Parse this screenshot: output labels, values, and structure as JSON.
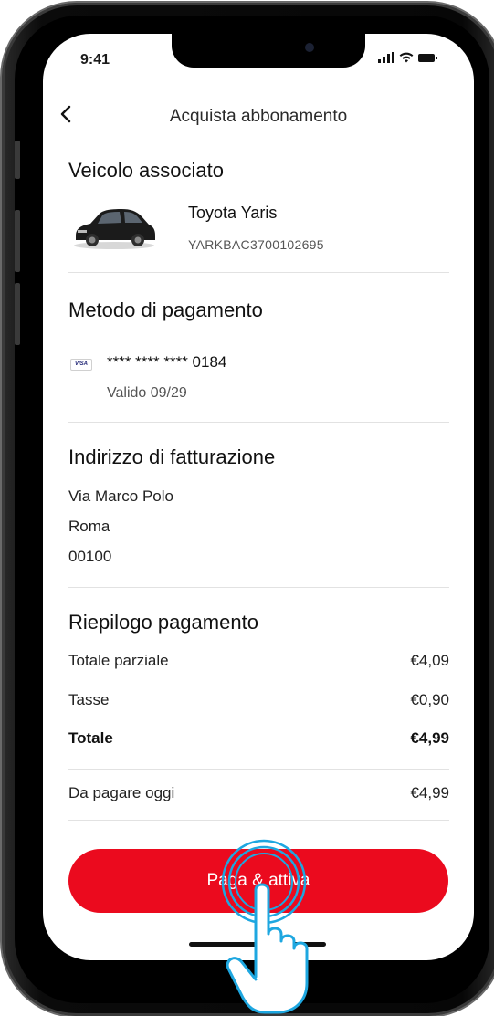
{
  "status_bar": {
    "time": "9:41",
    "icons": [
      "signal-icon",
      "wifi-icon",
      "battery-icon"
    ]
  },
  "header": {
    "back_icon": "chevron-left-icon",
    "title": "Acquista abbonamento"
  },
  "vehicle": {
    "section_title": "Veicolo associato",
    "name": "Toyota Yaris",
    "vin": "YARKBAC3700102695",
    "image_icon": "car-icon"
  },
  "payment_method": {
    "section_title": "Metodo di pagamento",
    "card_brand": "VISA",
    "card_number": "**** **** **** 0184",
    "valid": "Valido 09/29"
  },
  "billing_address": {
    "section_title": "Indirizzo di fatturazione",
    "street": "Via Marco Polo",
    "city": "Roma",
    "postcode": "00100"
  },
  "summary": {
    "section_title": "Riepilogo pagamento",
    "rows": [
      {
        "label": "Totale parziale",
        "value": "€4,09"
      },
      {
        "label": "Tasse",
        "value": "€0,90"
      },
      {
        "label": "Totale",
        "value": "€4,99"
      }
    ],
    "due_today": {
      "label": "Da pagare oggi",
      "value": "€4,99"
    }
  },
  "actions": {
    "pay_label": "Paga & attiva"
  },
  "colors": {
    "accent": "#eb0a1e",
    "tap_hint": "#1ea7e0",
    "divider": "#e2e2e2"
  }
}
